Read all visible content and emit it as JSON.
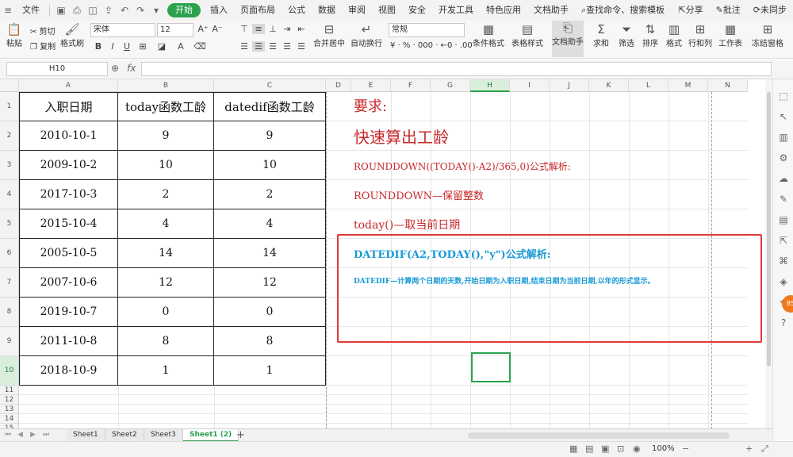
{
  "menubar": {
    "file": "文件",
    "tabs": [
      "开始",
      "插入",
      "页面布局",
      "公式",
      "数据",
      "审阅",
      "视图",
      "安全",
      "开发工具",
      "特色应用",
      "文档助手"
    ],
    "active_tab": "开始",
    "search_placeholder": "查找命令、搜索模板",
    "share": "分享",
    "comment": "批注",
    "sync": "未同步"
  },
  "ribbon": {
    "paste": "粘贴",
    "cut": "剪切",
    "copy": "复制",
    "format_painter": "格式刷",
    "font_name": "宋体",
    "font_size": "12",
    "merge_center": "合并居中",
    "wrap_text": "自动换行",
    "number_format": "常规",
    "conditional_format": "条件格式",
    "table_style": "表格样式",
    "doc_helper": "文档助手",
    "sum": "求和",
    "filter": "筛选",
    "sort": "排序",
    "format": "格式",
    "rows_cols": "行和列",
    "worksheet": "工作表",
    "freeze": "冻结窗格"
  },
  "formula_bar": {
    "name_box": "H10",
    "fx": "fx",
    "formula": ""
  },
  "columns": [
    "A",
    "B",
    "C",
    "D",
    "E",
    "F",
    "G",
    "H",
    "I",
    "J",
    "K",
    "L",
    "M",
    "N"
  ],
  "active_column": "H",
  "active_row": "10",
  "rows": [
    "1",
    "2",
    "3",
    "4",
    "5",
    "6",
    "7",
    "8",
    "9",
    "10",
    "11",
    "12",
    "13",
    "14",
    "15"
  ],
  "table": {
    "headers": [
      "入职日期",
      "today函数工龄",
      "datedif函数工龄"
    ],
    "data": [
      [
        "2010-10-1",
        "9",
        "9"
      ],
      [
        "2009-10-2",
        "10",
        "10"
      ],
      [
        "2017-10-3",
        "2",
        "2"
      ],
      [
        "2015-10-4",
        "4",
        "4"
      ],
      [
        "2005-10-5",
        "14",
        "14"
      ],
      [
        "2007-10-6",
        "12",
        "12"
      ],
      [
        "2019-10-7",
        "0",
        "0"
      ],
      [
        "2011-10-8",
        "8",
        "8"
      ],
      [
        "2018-10-9",
        "1",
        "1"
      ]
    ]
  },
  "notes": {
    "req": "要求:",
    "task": "快速算出工龄",
    "formula1": "ROUNDDOWN((TODAY()-A2)/365,0)公式解析:",
    "rounddown": "ROUNDDOWN—保留整数",
    "today": "today()—取当前日期",
    "formula2": "DATEDIF(A2,TODAY(),\"y\")公式解析:",
    "datedif": "DATEDIF—计算两个日期的天数,开始日期为入职日期,结束日期为当前日期,以年的形式显示。"
  },
  "colors": {
    "red_text": "#c8282a",
    "blue_text": "#1a9ad6",
    "accent": "#2ba24c"
  },
  "sheet_tabs": [
    "Sheet1",
    "Sheet2",
    "Sheet3",
    "Sheet1 (2)"
  ],
  "active_sheet": "Sheet1 (2)",
  "status": {
    "zoom": "100%"
  },
  "badge": "85"
}
